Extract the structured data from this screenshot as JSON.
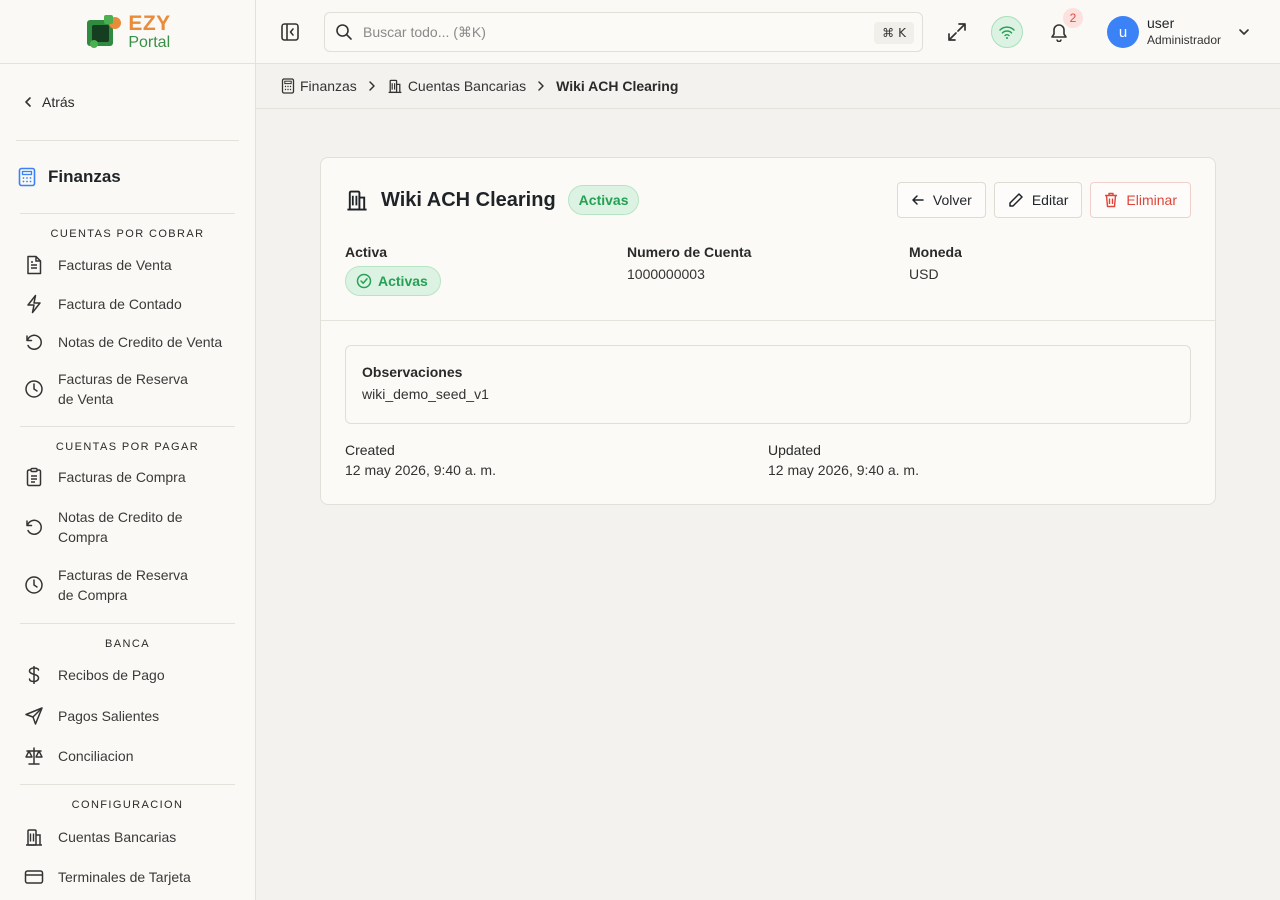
{
  "app": {
    "logo_text_top": "EZY",
    "logo_text_bottom": "Portal"
  },
  "header": {
    "search_placeholder": "Buscar todo... (⌘K)",
    "shortcut_symbol": "⌘",
    "shortcut_key": "K",
    "notification_count": "2",
    "user_initial": "u",
    "user_name": "user",
    "user_role": "Administrador"
  },
  "sidebar": {
    "back_label": "Atrás",
    "module_label": "Finanzas",
    "groups": [
      {
        "title": "CUENTAS POR COBRAR",
        "items": [
          {
            "label": "Facturas de Venta",
            "icon": "document-icon"
          },
          {
            "label": "Factura de Contado",
            "icon": "lightning-icon"
          },
          {
            "label": "Notas de Credito de Venta",
            "icon": "undo-icon"
          },
          {
            "label": "Facturas de Reserva de Venta",
            "icon": "clock-icon"
          }
        ]
      },
      {
        "title": "CUENTAS POR PAGAR",
        "items": [
          {
            "label": "Facturas de Compra",
            "icon": "clipboard-icon"
          },
          {
            "label": "Notas de Credito de Compra",
            "icon": "undo-icon"
          },
          {
            "label": "Facturas de Reserva de Compra",
            "icon": "clock-icon"
          }
        ]
      },
      {
        "title": "BANCA",
        "items": [
          {
            "label": "Recibos de Pago",
            "icon": "dollar-icon"
          },
          {
            "label": "Pagos Salientes",
            "icon": "send-icon"
          },
          {
            "label": "Conciliacion",
            "icon": "scale-icon"
          }
        ]
      },
      {
        "title": "CONFIGURACION",
        "items": [
          {
            "label": "Cuentas Bancarias",
            "icon": "bank-icon"
          },
          {
            "label": "Terminales de Tarjeta",
            "icon": "credit-card-icon"
          }
        ]
      }
    ]
  },
  "breadcrumb": {
    "items": [
      "Finanzas",
      "Cuentas Bancarias",
      "Wiki ACH Clearing"
    ]
  },
  "record": {
    "title": "Wiki ACH Clearing",
    "status_badge": "Activas",
    "buttons": {
      "back": "Volver",
      "edit": "Editar",
      "delete": "Eliminar"
    },
    "fields": {
      "active_label": "Activa",
      "active_value": "Activas",
      "account_number_label": "Numero de Cuenta",
      "account_number_value": "1000000003",
      "currency_label": "Moneda",
      "currency_value": "USD"
    },
    "observations": {
      "label": "Observaciones",
      "value": "wiki_demo_seed_v1"
    },
    "meta": {
      "created_label": "Created",
      "created_value": "12 may 2026, 9:40 a. m.",
      "updated_label": "Updated",
      "updated_value": "12 may 2026, 9:40 a. m."
    }
  },
  "colors": {
    "accent_green": "#25a054",
    "danger_red": "#e0453a",
    "avatar_blue": "#3b82f6",
    "logo_orange": "#e98b38"
  }
}
